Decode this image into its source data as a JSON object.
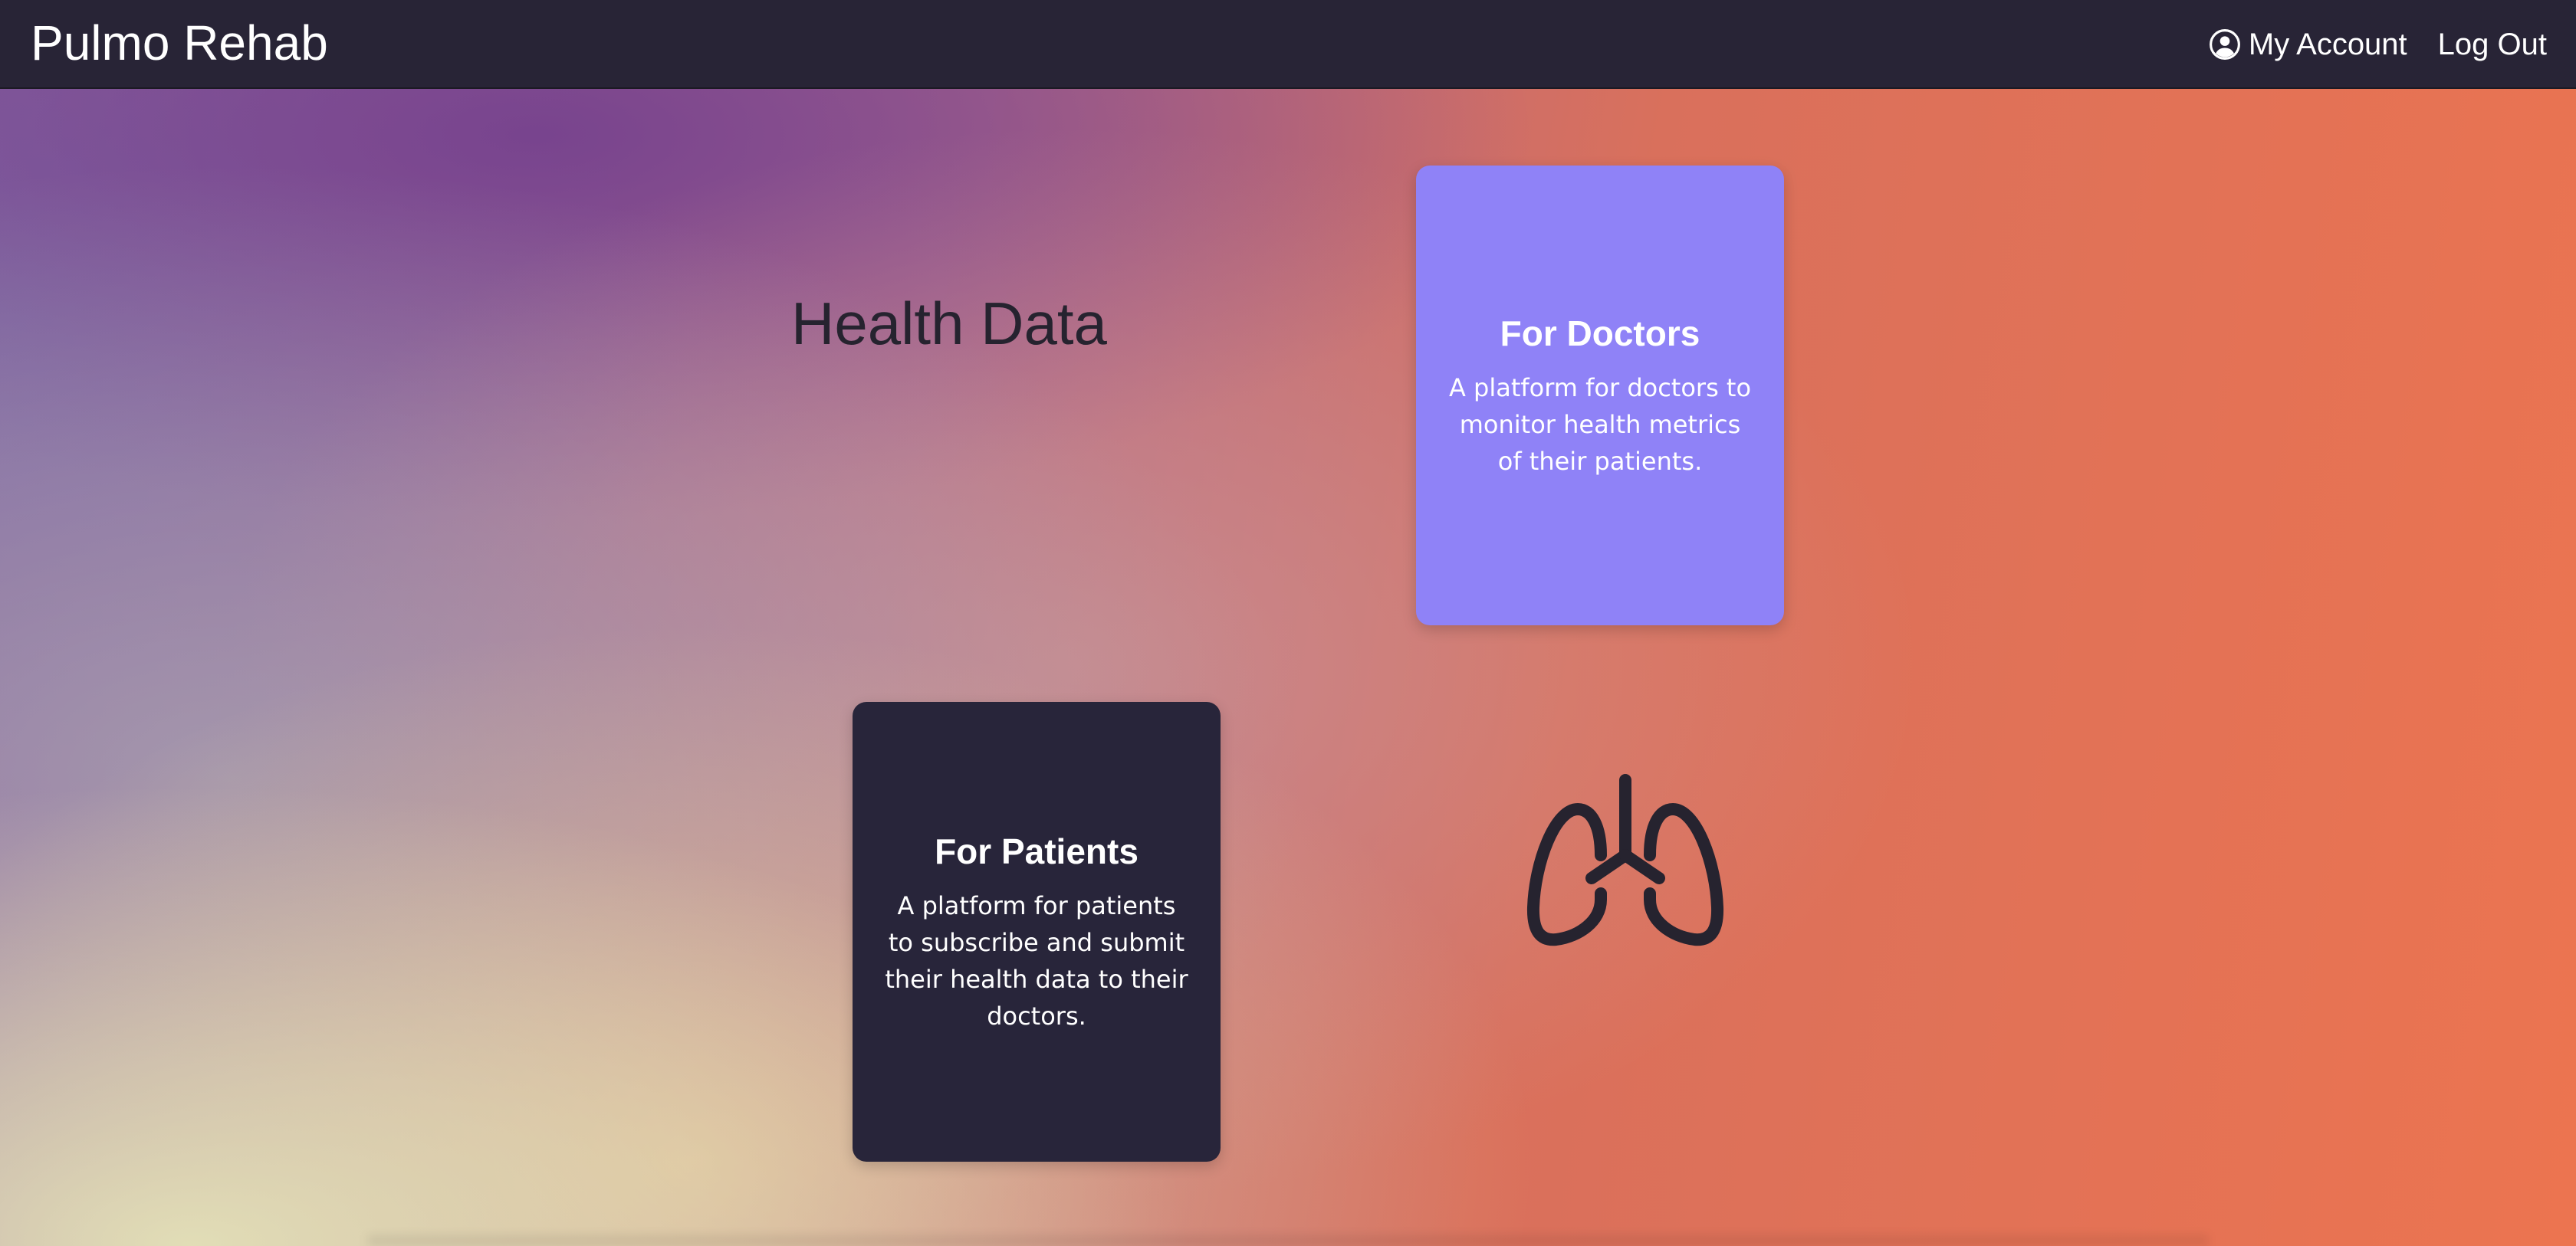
{
  "navbar": {
    "brand": "Pulmo Rehab",
    "account_icon": "user-circle-icon",
    "my_account_label": "My Account",
    "logout_label": "Log Out"
  },
  "hero": {
    "headline": "Health Data",
    "lungs_icon": "lungs-icon",
    "cards": {
      "doctors": {
        "title": "For Doctors",
        "description": "A platform for doctors to monitor health metrics of their patients.",
        "color": "#8f82f7"
      },
      "patients": {
        "title": "For Patients",
        "description": "A platform for patients to subscribe and submit their health data to their doctors.",
        "color": "#28253a"
      }
    }
  },
  "colors": {
    "navbar_bg": "#282436",
    "headline_text": "#26232f",
    "gradient_purple": "#76428e",
    "gradient_orange": "#ec7450",
    "gradient_cream": "#e4e2b8"
  }
}
